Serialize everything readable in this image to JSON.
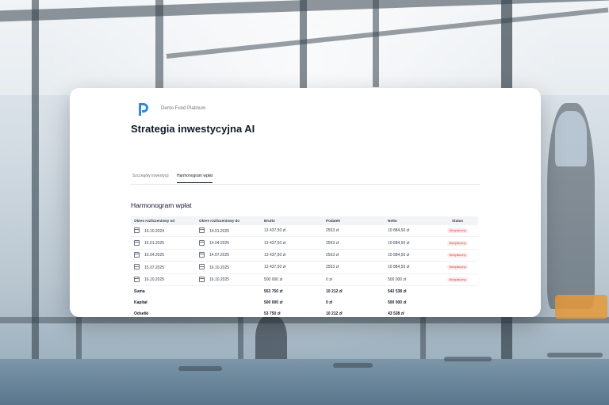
{
  "app": {
    "fund_name": "Demo Fund Platinum",
    "page_title": "Strategia inwestycyjna AI"
  },
  "tabs": [
    {
      "label": "Szczegóły inwestycji",
      "active": false
    },
    {
      "label": "Harmonogram wpłat",
      "active": true
    }
  ],
  "schedule": {
    "title": "Harmonogram wpłat",
    "columns": [
      "Okres rozliczeniowy od",
      "Okres rozliczeniowy do",
      "Brutto",
      "Podatek",
      "Netto",
      "Status"
    ],
    "rows": [
      {
        "from": "16.10.2024",
        "to": "14.01.2025",
        "gross": "13 437,50 zł",
        "tax": "2553 zł",
        "net": "10 884,50 zł",
        "status": "Nieopłacony"
      },
      {
        "from": "15.01.2025",
        "to": "14.04.2025",
        "gross": "13 437,50 zł",
        "tax": "2553 zł",
        "net": "10 884,50 zł",
        "status": "Nieopłacony"
      },
      {
        "from": "15.04.2025",
        "to": "14.07.2025",
        "gross": "13 437,50 zł",
        "tax": "2553 zł",
        "net": "10 884,50 zł",
        "status": "Nieopłacony"
      },
      {
        "from": "15.07.2025",
        "to": "16.10.2025",
        "gross": "13 437,50 zł",
        "tax": "2553 zł",
        "net": "10 884,50 zł",
        "status": "Nieopłacony"
      },
      {
        "from": "16.10.2025",
        "to": "16.10.2025",
        "gross": "500 000 zł",
        "tax": "0 zł",
        "net": "500 000 zł",
        "status": "Nieopłacony"
      }
    ],
    "summary": [
      {
        "label": "Suma",
        "gross": "553 750 zł",
        "tax": "10 212 zł",
        "net": "543 538 zł"
      },
      {
        "label": "Kapitał",
        "gross": "500 000 zł",
        "tax": "0 zł",
        "net": "500 000 zł"
      },
      {
        "label": "Odsetki",
        "gross": "53 750 zł",
        "tax": "10 212 zł",
        "net": "43 538 zł"
      }
    ]
  },
  "colors": {
    "logo": "#2d8be0",
    "status_badge_bg": "#fde8e8",
    "status_badge_text": "#d64545"
  },
  "icons": {
    "logo": "brand-p-logo",
    "date": "calendar-icon"
  }
}
